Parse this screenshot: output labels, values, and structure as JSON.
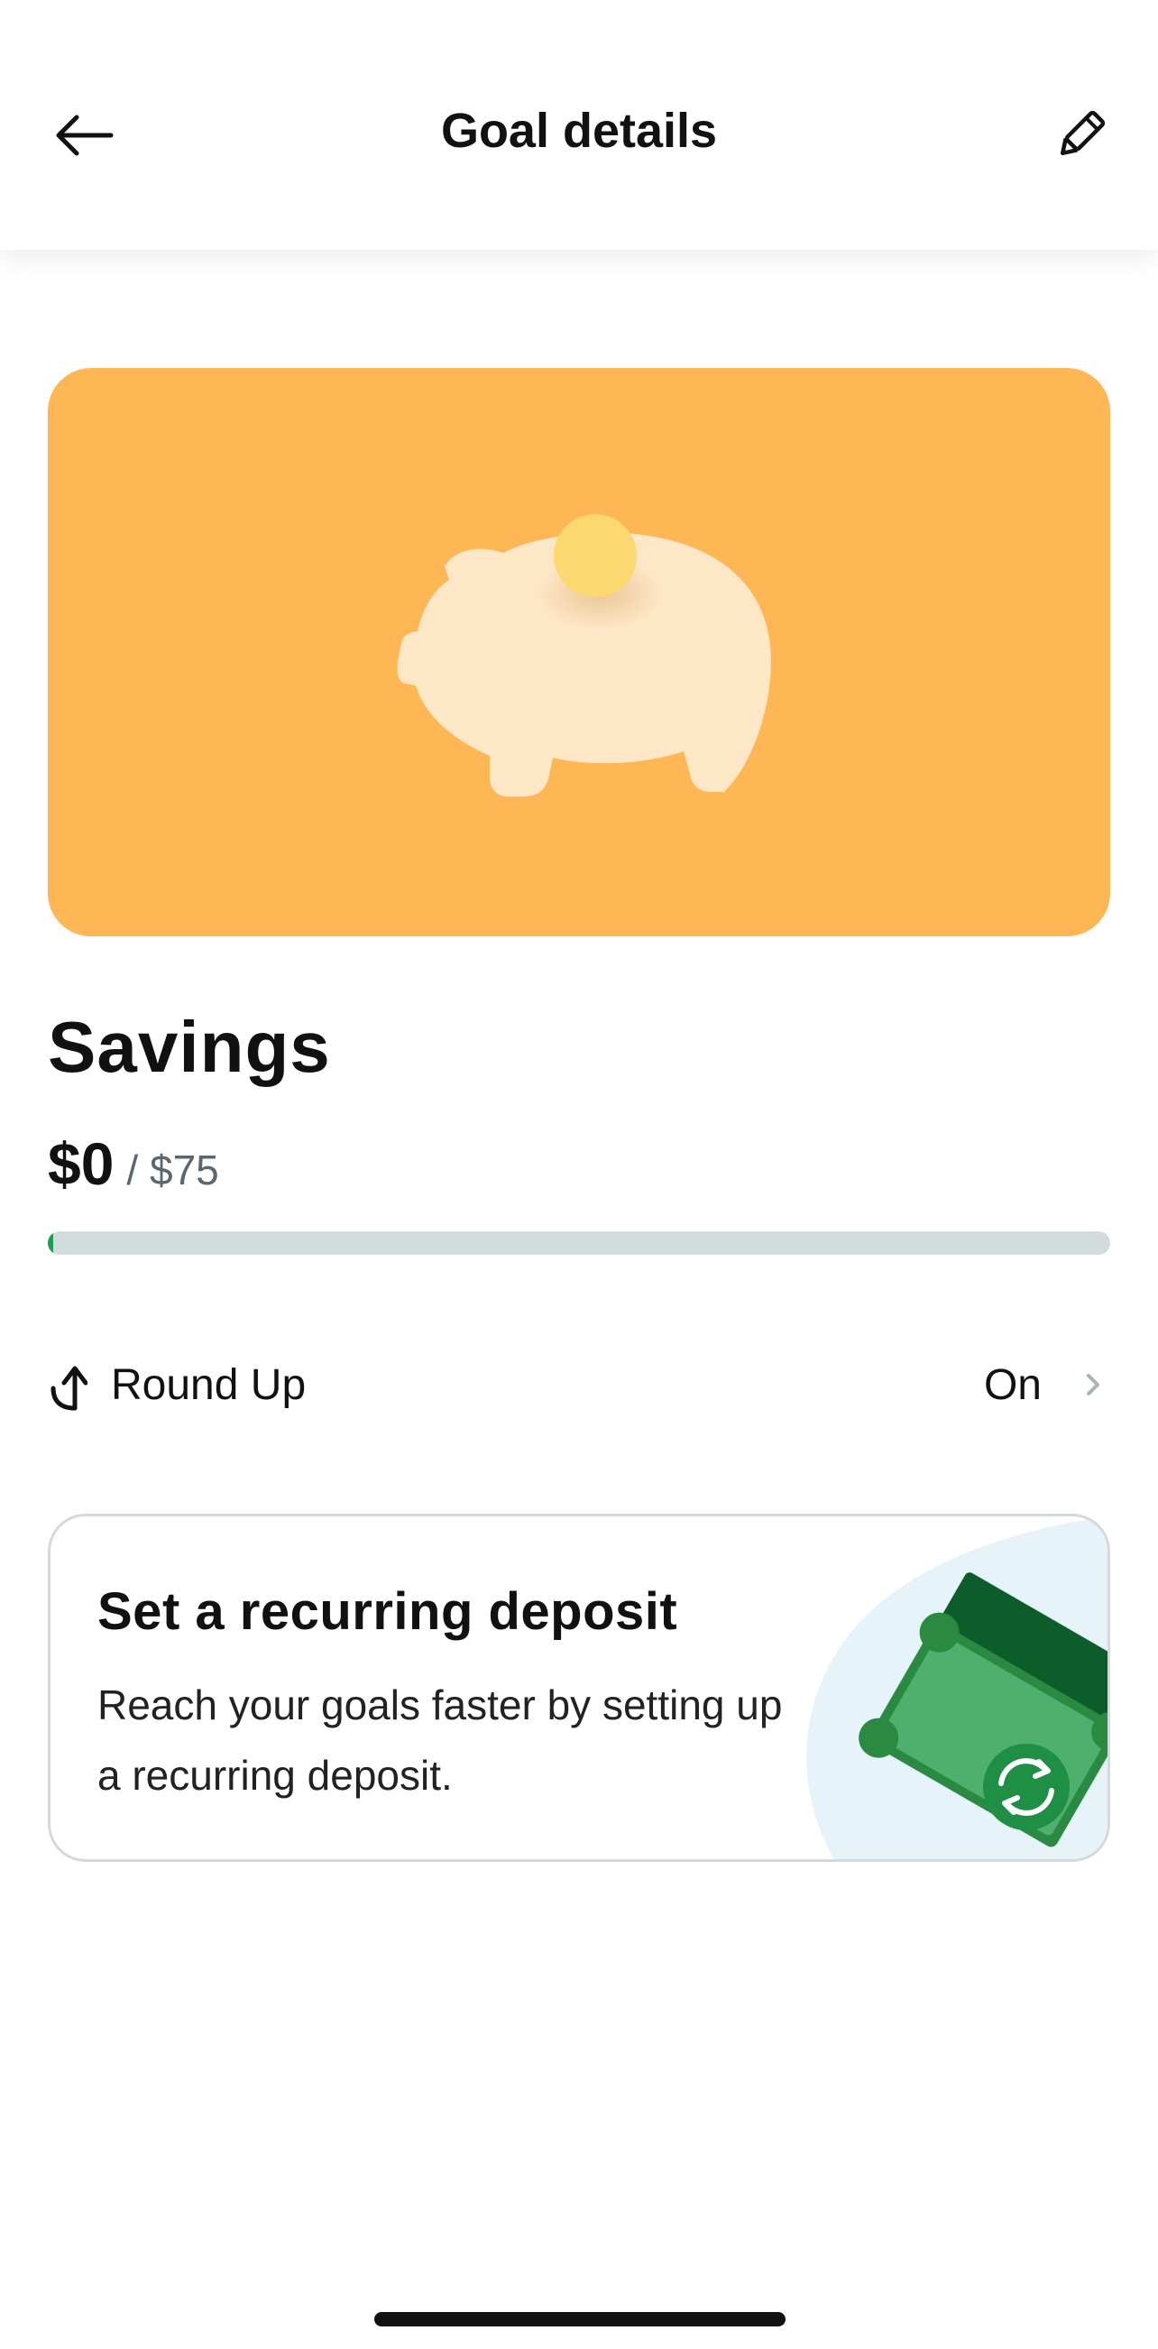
{
  "header": {
    "title": "Goal details",
    "back_icon": "arrow-left-icon",
    "edit_icon": "pencil-icon"
  },
  "hero": {
    "background_color": "#ffb655",
    "illustration": "piggy-bank-with-coin"
  },
  "goal": {
    "name": "Savings",
    "current_amount": "$0",
    "target_amount": "/ $75",
    "progress_fraction": 0
  },
  "round_up": {
    "icon": "round-up-arrow-icon",
    "label": "Round Up",
    "value": "On",
    "chevron_icon": "chevron-right-icon"
  },
  "recurring_card": {
    "title": "Set a recurring deposit",
    "description": "Reach your goals faster by setting up a recurring deposit.",
    "illustration": "money-bills-recurring-icon"
  },
  "colors": {
    "accent_green": "#1f9d55",
    "progress_track": "#d2dcdd",
    "hero_orange": "#ffb655"
  }
}
